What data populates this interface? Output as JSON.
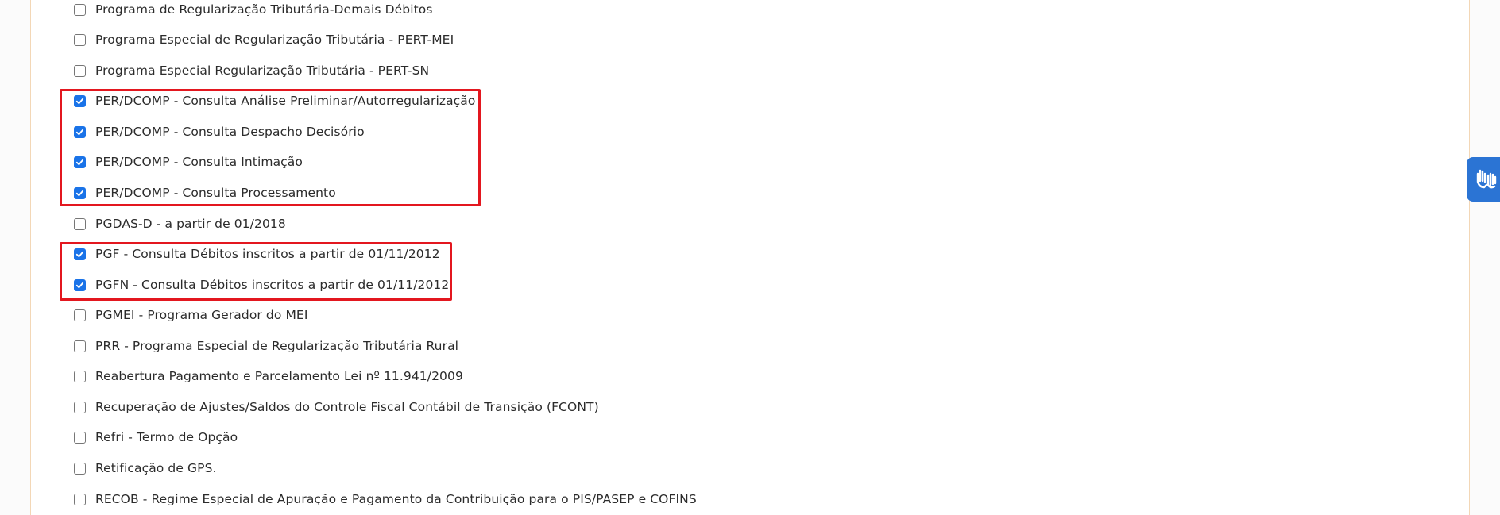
{
  "options": [
    {
      "label": "Programa de Regularização Tributária-Demais Débitos",
      "checked": false
    },
    {
      "label": "Programa Especial de Regularização Tributária - PERT-MEI",
      "checked": false
    },
    {
      "label": "Programa Especial Regularização Tributária - PERT-SN",
      "checked": false
    },
    {
      "label": "PER/DCOMP - Consulta Análise Preliminar/Autorregularização",
      "checked": true
    },
    {
      "label": "PER/DCOMP - Consulta Despacho Decisório",
      "checked": true
    },
    {
      "label": "PER/DCOMP - Consulta Intimação",
      "checked": true
    },
    {
      "label": "PER/DCOMP - Consulta Processamento",
      "checked": true
    },
    {
      "label": "PGDAS-D - a partir de 01/2018",
      "checked": false
    },
    {
      "label": "PGF - Consulta Débitos inscritos a partir de 01/11/2012",
      "checked": true
    },
    {
      "label": "PGFN - Consulta Débitos inscritos a partir de 01/11/2012",
      "checked": true
    },
    {
      "label": "PGMEI - Programa Gerador do MEI",
      "checked": false
    },
    {
      "label": "PRR - Programa Especial de Regularização Tributária Rural",
      "checked": false
    },
    {
      "label": "Reabertura Pagamento e Parcelamento Lei nº 11.941/2009",
      "checked": false
    },
    {
      "label": "Recuperação de Ajustes/Saldos do Controle Fiscal Contábil de Transição (FCONT)",
      "checked": false
    },
    {
      "label": "Refri - Termo de Opção",
      "checked": false
    },
    {
      "label": "Retificação de GPS.",
      "checked": false
    },
    {
      "label": "RECOB - Regime Especial de Apuração e Pagamento da Contribuição para o PIS/PASEP e COFINS",
      "checked": false
    }
  ],
  "colors": {
    "checkbox_checked": "#1a73e8",
    "highlight": "#e3171f",
    "accessibility_button": "#2b74d4"
  },
  "accessibility_widget": {
    "icon": "sign-language-hands-icon"
  }
}
